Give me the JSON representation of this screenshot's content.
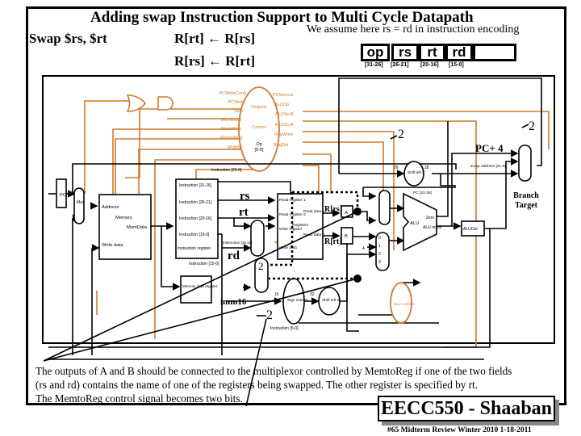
{
  "title": "Adding swap  Instruction Support to Multi Cycle Datapath",
  "assumption": "We assume here  rs = rd   in instruction encoding",
  "instruction": "Swap  $rs, $rt",
  "rtl": [
    "R[rt] ←  R[rs]",
    "R[rs] ←  R[rt]"
  ],
  "encoding": {
    "fields": [
      {
        "name": "op",
        "bits": "[31-26]"
      },
      {
        "name": "rs",
        "bits": "[26-21]"
      },
      {
        "name": "rt",
        "bits": "[20-16]"
      },
      {
        "name": "rd",
        "bits": "[15-0]"
      },
      {
        "name": "",
        "bits": ""
      }
    ]
  },
  "control": {
    "unit_labels": [
      "Outputs",
      "Control",
      "Op",
      "[5-0]"
    ],
    "left_signals": [
      "PCWriteCond",
      "PCWrite",
      "IorD",
      "MemRead",
      "MemWrite",
      "MemtoReg",
      "IRWrite"
    ],
    "right_signals": [
      "PCSource",
      "ALUOp",
      "ALUSrcB",
      "ALUSrcA",
      "RegWrite",
      "RegDst"
    ]
  },
  "datapath": {
    "pc": "PC",
    "mux": "Mux",
    "memory": {
      "title": "Memory",
      "address": "Address",
      "memdata": "MemData",
      "write_data": "Write data"
    },
    "ir": {
      "fields": [
        "Instruction [31-26]",
        "Instruction [25-21]",
        "Instruction [20-16]",
        "Instruction [15-0]"
      ],
      "label": "Instruction register"
    },
    "instr_25_0": "Instruction [25-0]",
    "instr_15_11": "Instruction [15-11]",
    "instr_15_0": "Instruction [15-0]",
    "instr_5_0": "Instruction [5-0]",
    "mdr": "Memory data register",
    "regs": {
      "r1": "Read register 1",
      "r2": "Read register 2",
      "wr": "Write register",
      "wd": "Write data",
      "rd1": "Read data 1",
      "rd2": "Read data 2",
      "title": "Registers"
    },
    "a": "A",
    "b": "B",
    "sign_extend": "Sign extend",
    "shift_left2": "Shift left 2",
    "alu": "ALU",
    "zero": "Zero",
    "alu_result": "ALU result",
    "aluout": "ALUOut",
    "alu_control": "ALU control",
    "jump_address": "Jump address [31-0]",
    "pc_31_28": "PC [31-28]",
    "bits_16": "16",
    "bits_32": "32",
    "bits_26": "26",
    "bits_28": "28",
    "four": "4",
    "mux_inputs": [
      "0",
      "1",
      "2",
      "3"
    ]
  },
  "annotations": {
    "rs": "rs",
    "rt": "rt",
    "rd": "rd",
    "imm16": "imm16",
    "r_rs": "R[rs]",
    "r_rt": "R[rt]",
    "two": "2",
    "pc_plus_4": "PC+ 4",
    "branch_target": "Branch Target"
  },
  "note": [
    "The outputs of A and B should be connected to the multiplexor controlled by MemtoReg if one of the two fields",
    " (rs and rd) contains the name of one of the registers being swapped.  The other register is specified by rt.",
    " The MemtoReg control signal becomes two bits."
  ],
  "brand": "EECC550 - Shaaban",
  "footer": "#65   Midterm Review   Winter 2010  1-18-2011",
  "colors": {
    "control": "#d07a2c",
    "wire": "#000000",
    "shadow": "#888888"
  }
}
